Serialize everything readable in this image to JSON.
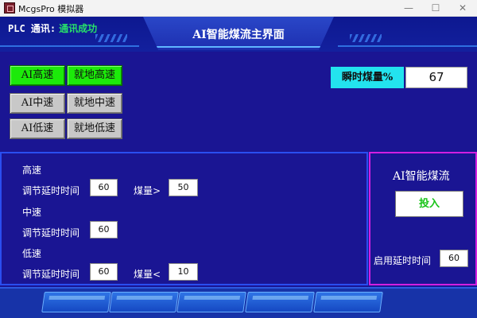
{
  "window": {
    "title": "McgsPro 模拟器",
    "min_glyph": "—",
    "max_glyph": "☐",
    "close_glyph": "✕"
  },
  "header": {
    "plc_label": "PLC 通讯:",
    "plc_status": "通讯成功",
    "title": "AI智能煤流主界面"
  },
  "speed_buttons": [
    {
      "label": "AI高速",
      "active": true
    },
    {
      "label": "就地高速",
      "active": true
    },
    {
      "label": "AI中速",
      "active": false
    },
    {
      "label": "就地中速",
      "active": false
    },
    {
      "label": "AI低速",
      "active": false
    },
    {
      "label": "就地低速",
      "active": false
    }
  ],
  "coal": {
    "label": "瞬时煤量%",
    "value": "67"
  },
  "settings": {
    "high": {
      "title": "高速",
      "delay_label": "调节延时时间",
      "delay_value": "60",
      "threshold_label": "煤量>",
      "threshold_value": "50"
    },
    "medium": {
      "title": "中速",
      "delay_label": "调节延时时间",
      "delay_value": "60"
    },
    "low": {
      "title": "低速",
      "delay_label": "调节延时时间",
      "delay_value": "60",
      "threshold_label": "煤量<",
      "threshold_value": "10"
    }
  },
  "ai_panel": {
    "title": "AI智能煤流",
    "button_label": "投入",
    "enable_delay_label": "启用延时时间",
    "enable_delay_value": "60"
  },
  "colors": {
    "background": "#1a1593",
    "active_button": "#1cea0a",
    "status_text": "#27e06a",
    "coal_label_bg": "#23e3ee",
    "left_border": "#2a4ef0",
    "right_border": "#d21fe0"
  }
}
